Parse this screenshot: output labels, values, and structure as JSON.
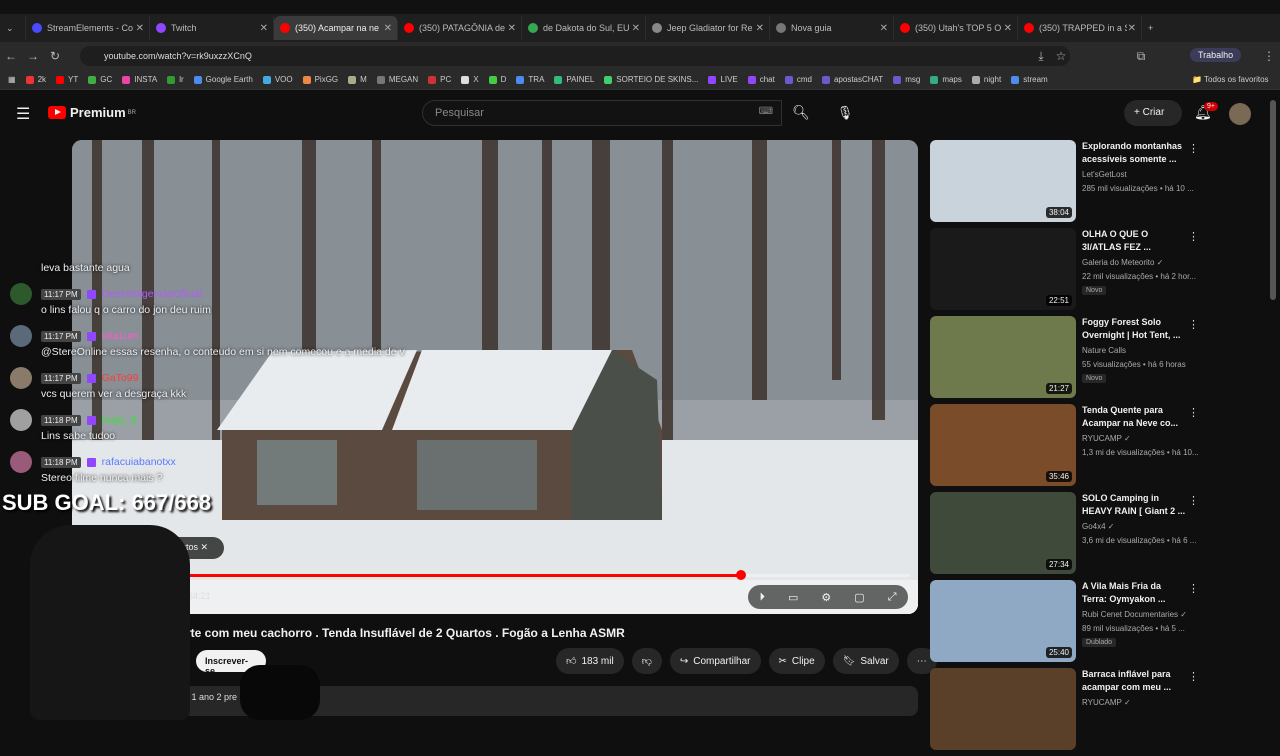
{
  "browser": {
    "tabs": [
      {
        "label": "StreamElements - Co",
        "color": "#4a4aff"
      },
      {
        "label": "Twitch",
        "color": "#9146ff"
      },
      {
        "label": "(350) Acampar na ne",
        "color": "#ff0000",
        "active": true
      },
      {
        "label": "(350) PATAGÔNIA de",
        "color": "#ff0000"
      },
      {
        "label": "de Dakota do Sul, EU",
        "color": "#34a853"
      },
      {
        "label": "Jeep Gladiator for Re",
        "color": "#888888"
      },
      {
        "label": "Nova guia",
        "color": "#777777"
      },
      {
        "label": "(350) Utah's TOP 5 O",
        "color": "#ff0000"
      },
      {
        "label": "(350) TRAPPED in a S",
        "color": "#ff0000"
      }
    ],
    "url": "youtube.com/watch?v=rk9uxzzXCnQ",
    "profile_label": "Trabalho",
    "bookmarks": [
      "2k",
      "YT",
      "GC",
      "INSTA",
      "lr",
      "Google Earth",
      "VOO",
      "PixGG",
      "M",
      "MEGAN",
      "PC",
      "X",
      "D",
      "TRA",
      "PAINEL",
      "SORTEIO DE SKINS...",
      "LIVE",
      "chat",
      "cmd",
      "apostasCHAT",
      "msg",
      "maps",
      "night",
      "stream"
    ],
    "favorites_label": "Todos os favoritos"
  },
  "youtube": {
    "logo_text": "Premium",
    "logo_sup": "BR",
    "search_placeholder": "Pesquisar",
    "create_label": "+ Criar",
    "notif_count": "9+",
    "video": {
      "time": "34:21",
      "progress": 0.79,
      "products_chip": "s produtos",
      "title": "rte com meu cachorro . Tenda Insuflável de 2 Quartos . Fogão a Lenha ASMR",
      "subscribe_label": "Inscrever-se",
      "like_count": "183 mil",
      "share_label": "Compartilhar",
      "clip_label": "Clipe",
      "save_label": "Salvar",
      "desc_text": "é 1 ano  2 pre"
    },
    "recommended": [
      {
        "title": "Explorando montanhas acessíveis somente ...",
        "channel": "Let'sGetLost",
        "meta": "285 mil visualizações • há 10 ...",
        "duration": "38:04",
        "badge": "",
        "thumb": "#c9d3dc"
      },
      {
        "title": "OLHA O QUE O 3I/ATLAS FEZ ...",
        "channel": "Galeria do Meteorito ✓",
        "meta": "22 mil visualizações • há 2 hor...",
        "duration": "22:51",
        "badge": "Novo",
        "thumb": "#1a1a1a"
      },
      {
        "title": "Foggy Forest Solo Overnight | Hot Tent, ...",
        "channel": "Nature Calls",
        "meta": "55 visualizações • há 6 horas",
        "duration": "21:27",
        "badge": "Novo",
        "thumb": "#6f7a4c"
      },
      {
        "title": "Tenda Quente para Acampar na Neve co...",
        "channel": "RYUCAMP ✓",
        "meta": "1,3 mi de visualizações • há 10...",
        "duration": "35:46",
        "badge": "",
        "thumb": "#7a4c2a"
      },
      {
        "title": "SOLO Camping in HEAVY RAIN [ Giant 2 ...",
        "channel": "Go4x4 ✓",
        "meta": "3,6 mi de visualizações • há 6 ...",
        "duration": "27:34",
        "badge": "",
        "thumb": "#3f4a3a"
      },
      {
        "title": "A Vila Mais Fria da Terra: Oymyakon ...",
        "channel": "Rubi Cenet Documentaries ✓",
        "meta": "89 mil visualizações • há 5 ...",
        "duration": "25:40",
        "badge": "Dublado",
        "thumb": "#8fa9c4"
      },
      {
        "title": "Barraca inflável para acampar com meu ...",
        "channel": "RYUCAMP ✓",
        "meta": "",
        "duration": "",
        "badge": "",
        "thumb": "#5a4028"
      }
    ]
  },
  "overlay": {
    "chat": [
      {
        "time": "",
        "user": "",
        "user_color": "#ffffff",
        "text": "leva bastante agua",
        "avatar": "#3b3b3b"
      },
      {
        "time": "11:17 PM",
        "user": "DesinteligenciaOficial",
        "user_color": "#b05cff",
        "text": "o lins falou q o carro do jon deu ruim",
        "avatar": "#2c5a2c"
      },
      {
        "time": "11:17 PM",
        "user": "vita1um",
        "user_color": "#ff5ad1",
        "text": "@StereOnline essas resenha, o conteudo em si nem comecou e a media de v",
        "avatar": "#5a6a7a"
      },
      {
        "time": "11:17 PM",
        "user": "GaTo99",
        "user_color": "#ff3b3b",
        "text": "vcs querem ver a desgraça kkk",
        "avatar": "#8a7a6a"
      },
      {
        "time": "11:18 PM",
        "user": "hugo_9",
        "user_color": "#3be03b",
        "text": "Lins sabe tudoo",
        "avatar": "#a0a0a0"
      },
      {
        "time": "11:18 PM",
        "user": "rafacuiabanotxx",
        "user_color": "#5a7aff",
        "text": "Stereo filme nunca mais ?",
        "avatar": "#9a5a7a"
      }
    ],
    "sub_goal": "SUB GOAL: 667/668"
  }
}
